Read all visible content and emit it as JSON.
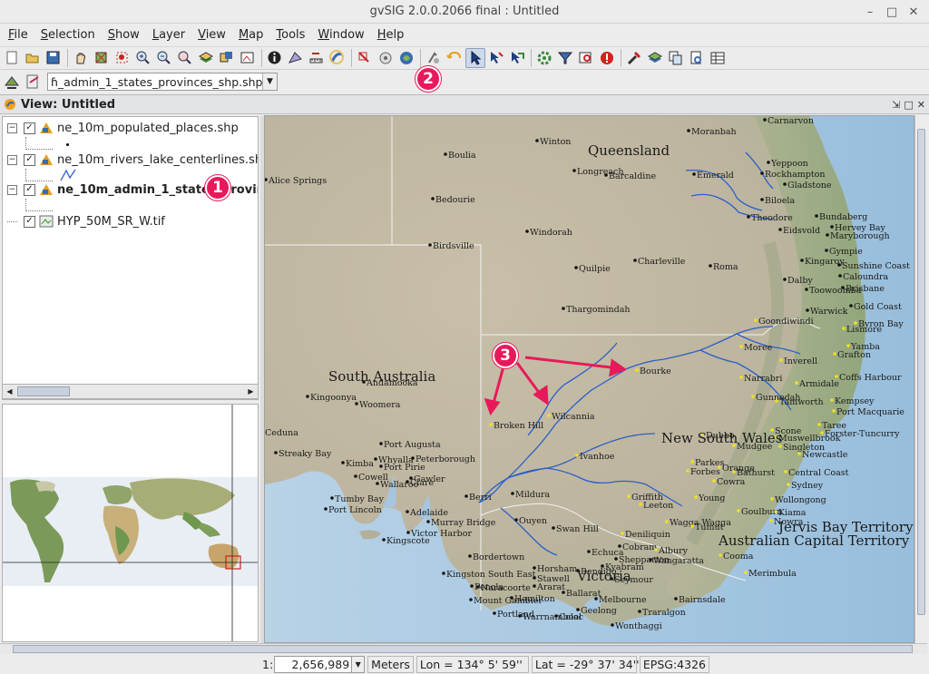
{
  "window": {
    "title": "gvSIG 2.0.0.2066 final : Untitled",
    "controls": {
      "minimize": "–",
      "maximize": "□",
      "close": "✕"
    }
  },
  "menu": [
    {
      "id": "file",
      "u": "F",
      "rest": "ile"
    },
    {
      "id": "selection",
      "u": "S",
      "rest": "election"
    },
    {
      "id": "show",
      "u": "S",
      "rest": "how"
    },
    {
      "id": "layer",
      "u": "L",
      "rest": "ayer"
    },
    {
      "id": "view",
      "u": "V",
      "rest": "iew"
    },
    {
      "id": "map",
      "u": "M",
      "rest": "ap"
    },
    {
      "id": "tools",
      "u": "T",
      "rest": "ools"
    },
    {
      "id": "window",
      "u": "W",
      "rest": "indow"
    },
    {
      "id": "help",
      "u": "H",
      "rest": "elp"
    }
  ],
  "toolbar": {
    "groups": [
      [
        "new-document",
        "open-project",
        "save-project"
      ],
      [
        "pan",
        "zoom-full",
        "zoom-select",
        "zoom-in",
        "zoom-out",
        "zoom-previous",
        "layers",
        "zoom-layer",
        "frame"
      ],
      [
        "info",
        "measure-area",
        "measure-distance",
        "hyperlink"
      ],
      [
        "select-by-point",
        "select-by-rectangle",
        "select-by-polygon"
      ],
      [
        "locate",
        "rotate",
        "pointer-select",
        "select-by-line",
        "select-polyline"
      ],
      [
        "gear",
        "filter",
        "query",
        "error"
      ],
      [
        "preferences",
        "add-layer",
        "copy",
        "zoom-doc",
        "table"
      ]
    ],
    "active": "pointer-select"
  },
  "layer_selector": {
    "value": "ɦ_admin_1_states_provinces_shp.shp"
  },
  "view": {
    "title": "View: Untitled"
  },
  "toc": {
    "layers": [
      {
        "name": "ne_10m_populated_places.shp",
        "checked": true,
        "bold": false,
        "icon": "point-layer-icon"
      },
      {
        "name": "ne_10m_rivers_lake_centerlines.shp",
        "checked": true,
        "bold": false,
        "icon": "line-layer-icon"
      },
      {
        "name": "ne_10m_admin_1_states_provinces_shp.shp",
        "checked": true,
        "bold": true,
        "icon": "polygon-layer-icon"
      },
      {
        "name": "HYP_50M_SR_W.tif",
        "checked": true,
        "bold": false,
        "icon": "raster-layer-icon"
      }
    ]
  },
  "map": {
    "regions": [
      "Queensland",
      "South Australia",
      "New South Wales",
      "Jervis Bay Territory",
      "Australian Capital Territory",
      "Victoria"
    ],
    "places": [
      "Moranbah",
      "Winton",
      "Yeppoon",
      "Rockhampton",
      "Boulia",
      "Longreach",
      "Barcaldine",
      "Emerald",
      "Gladstone",
      "Alice Springs",
      "Biloela",
      "Bedourie",
      "Theodore",
      "Bundaberg",
      "Hervey Bay",
      "Eidsvold",
      "Maryborough",
      "Windorah",
      "Gympie",
      "Birdsville",
      "Charleville",
      "Kingaroy",
      "Sunshine Coast",
      "Caloundra",
      "Roma",
      "Quilpie",
      "Dalby",
      "Brisbane",
      "Toowoomba",
      "Thargomindah",
      "Gold Coast",
      "Warwick",
      "Byron Bay",
      "Goondiwindi",
      "Lismore",
      "Moree",
      "Yamba",
      "Inverell",
      "Grafton",
      "Bourke",
      "Coffs Harbour",
      "Narrabri",
      "Armidale",
      "Gunnedah",
      "Kempsey",
      "Tamworth",
      "Port Macquarie",
      "Wilcannia",
      "Broken Hill",
      "Taree",
      "Forster-Tuncurry",
      "Dubbo",
      "Scone",
      "Muswellbrook",
      "Mudgee",
      "Singleton",
      "Newcastle",
      "Ivanhoe",
      "Orange",
      "Parkes",
      "Bathurst",
      "Forbes",
      "Cowra",
      "Central Coast",
      "Sydney",
      "Kingoonya",
      "Andamooka",
      "Woomera",
      "Ceduna",
      "Port Augusta",
      "Streaky Bay",
      "Whyalla",
      "Port Pirie",
      "Peterborough",
      "Kimba",
      "Clare",
      "Cowell",
      "Wallaroo",
      "Tumby Bay",
      "Port Lincoln",
      "Gawler",
      "Adelaide",
      "Murray Bridge",
      "Victor Harbor",
      "Kingscote",
      "Berri",
      "Mildura",
      "Ouyen",
      "Swan Hill",
      "Deniliquin",
      "Griffith",
      "Leeton",
      "Young",
      "Wagga Wagga",
      "Goulburn",
      "Wollongong",
      "Kiama",
      "Nowra",
      "Tumut",
      "Echuca",
      "Cobram",
      "Albury",
      "Wangaratta",
      "Shepparton",
      "Cooma",
      "Bordertown",
      "Horsham",
      "Kingston South East",
      "Stawell",
      "Ararat",
      "Bendigo",
      "Naracoorte",
      "Penola",
      "Mount Gambier",
      "Hamilton",
      "Ballarat",
      "Melbourne",
      "Geelong",
      "Portland",
      "Warrnambool",
      "Colac",
      "Traralgon",
      "Wonthaggi",
      "Bairnsdale",
      "Merimbula",
      "Seymour",
      "Kyabram",
      "Carnarvon",
      "Dubbo"
    ]
  },
  "callouts": [
    "1",
    "2",
    "3"
  ],
  "status": {
    "scale_prefix": "1:",
    "scale": "2,656,989",
    "units": "Meters",
    "lon": "Lon = 134° 5' 59''",
    "lat": "Lat = -29° 37' 34''",
    "epsg": "EPSG:4326"
  },
  "colors": {
    "accent": "#e8195a",
    "ocean": "#a9c8e0",
    "land": "#c3baa6",
    "river": "#2a5fc8",
    "selection": "#2a63b0"
  }
}
